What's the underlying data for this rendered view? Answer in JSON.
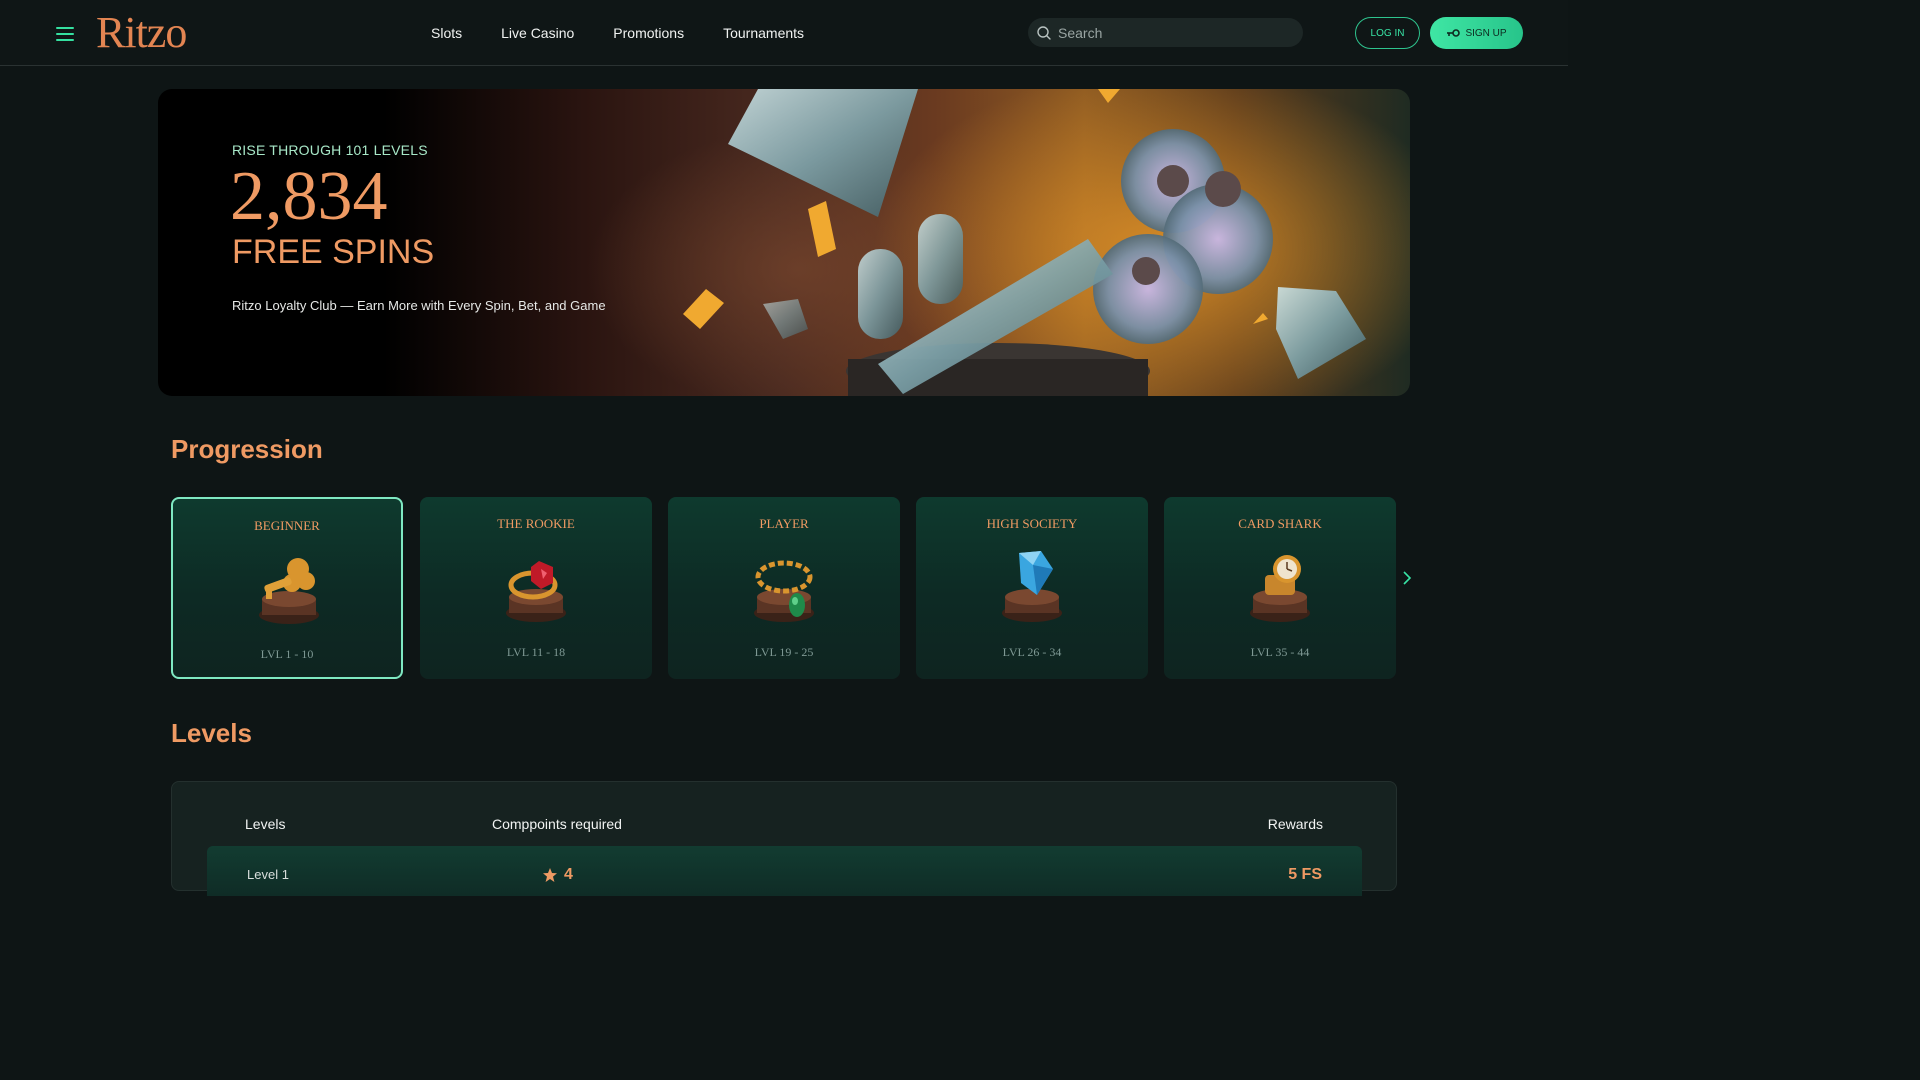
{
  "header": {
    "logo": "Ritzo",
    "nav": [
      "Slots",
      "Live Casino",
      "Promotions",
      "Tournaments"
    ],
    "search_placeholder": "Search",
    "login_label": "LOG IN",
    "signup_label": "SIGN UP"
  },
  "hero": {
    "kicker": "RISE THROUGH 101 LEVELS",
    "number": "2,834",
    "title": "FREE SPINS",
    "subtitle": "Ritzo Loyalty Club — Earn More with Every Spin, Bet, and Game"
  },
  "progression": {
    "title": "Progression",
    "cards": [
      {
        "name": "BEGINNER",
        "levels": "LVL 1 - 10",
        "icon": "key-trophy-icon",
        "active": true
      },
      {
        "name": "THE ROOKIE",
        "levels": "LVL 11 - 18",
        "icon": "ruby-ring-icon",
        "active": false
      },
      {
        "name": "PLAYER",
        "levels": "LVL 19 - 25",
        "icon": "gold-chain-icon",
        "active": false
      },
      {
        "name": "HIGH SOCIETY",
        "levels": "LVL 26 - 34",
        "icon": "diamond-icon",
        "active": false
      },
      {
        "name": "CARD SHARK",
        "levels": "LVL 35 - 44",
        "icon": "gold-watch-icon",
        "active": false
      }
    ]
  },
  "levels": {
    "title": "Levels",
    "headers": {
      "level": "Levels",
      "points": "Comppoints required",
      "rewards": "Rewards"
    },
    "rows": [
      {
        "level": "Level 1",
        "points": "4",
        "reward": "5 FS"
      }
    ]
  },
  "colors": {
    "accent": "#ef9a63",
    "brand_green": "#38e3a5",
    "background": "#0e1515"
  }
}
